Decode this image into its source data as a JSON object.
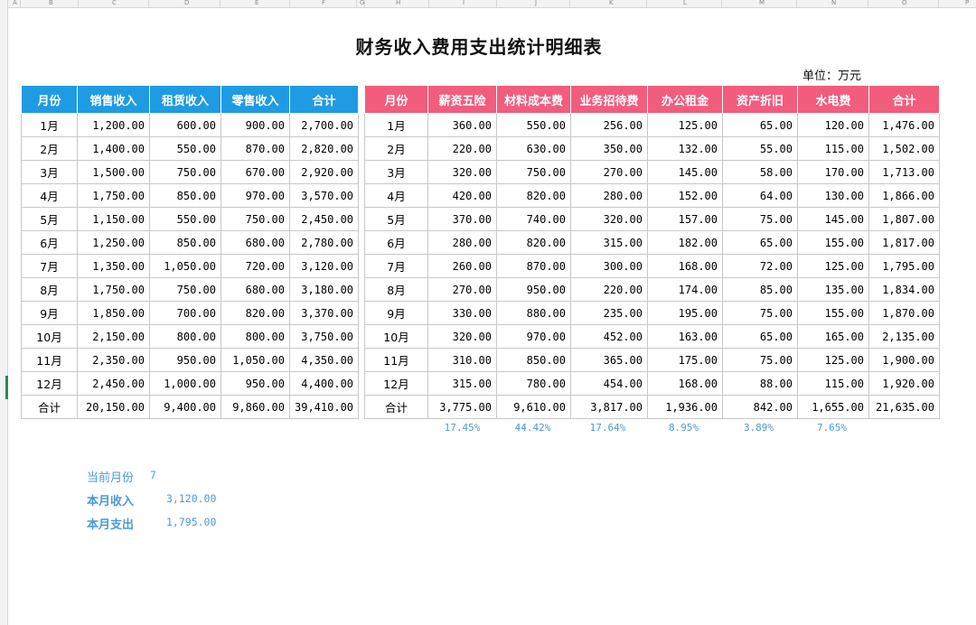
{
  "sheet": {
    "columns": [
      "A",
      "B",
      "C",
      "D",
      "E",
      "F",
      "G",
      "H",
      "I",
      "J",
      "K",
      "L",
      "M",
      "N",
      "O",
      "P"
    ],
    "title": "财务收入费用支出统计明细表",
    "unit": "单位：万元"
  },
  "income": {
    "headers": [
      "月份",
      "销售收入",
      "租赁收入",
      "零售收入",
      "合计"
    ],
    "rows": [
      [
        "1月",
        "1,200.00",
        "600.00",
        "900.00",
        "2,700.00"
      ],
      [
        "2月",
        "1,400.00",
        "550.00",
        "870.00",
        "2,820.00"
      ],
      [
        "3月",
        "1,500.00",
        "750.00",
        "670.00",
        "2,920.00"
      ],
      [
        "4月",
        "1,750.00",
        "850.00",
        "970.00",
        "3,570.00"
      ],
      [
        "5月",
        "1,150.00",
        "550.00",
        "750.00",
        "2,450.00"
      ],
      [
        "6月",
        "1,250.00",
        "850.00",
        "680.00",
        "2,780.00"
      ],
      [
        "7月",
        "1,350.00",
        "1,050.00",
        "720.00",
        "3,120.00"
      ],
      [
        "8月",
        "1,750.00",
        "750.00",
        "680.00",
        "3,180.00"
      ],
      [
        "9月",
        "1,850.00",
        "700.00",
        "820.00",
        "3,370.00"
      ],
      [
        "10月",
        "2,150.00",
        "800.00",
        "800.00",
        "3,750.00"
      ],
      [
        "11月",
        "2,350.00",
        "950.00",
        "1,050.00",
        "4,350.00"
      ],
      [
        "12月",
        "2,450.00",
        "1,000.00",
        "950.00",
        "4,400.00"
      ],
      [
        "合计",
        "20,150.00",
        "9,400.00",
        "9,860.00",
        "39,410.00"
      ]
    ]
  },
  "expense": {
    "headers": [
      "月份",
      "薪资五险",
      "材料成本费",
      "业务招待费",
      "办公租金",
      "资产折旧",
      "水电费",
      "合计"
    ],
    "rows": [
      [
        "1月",
        "360.00",
        "550.00",
        "256.00",
        "125.00",
        "65.00",
        "120.00",
        "1,476.00"
      ],
      [
        "2月",
        "220.00",
        "630.00",
        "350.00",
        "132.00",
        "55.00",
        "115.00",
        "1,502.00"
      ],
      [
        "3月",
        "320.00",
        "750.00",
        "270.00",
        "145.00",
        "58.00",
        "170.00",
        "1,713.00"
      ],
      [
        "4月",
        "420.00",
        "820.00",
        "280.00",
        "152.00",
        "64.00",
        "130.00",
        "1,866.00"
      ],
      [
        "5月",
        "370.00",
        "740.00",
        "320.00",
        "157.00",
        "75.00",
        "145.00",
        "1,807.00"
      ],
      [
        "6月",
        "280.00",
        "820.00",
        "315.00",
        "182.00",
        "65.00",
        "155.00",
        "1,817.00"
      ],
      [
        "7月",
        "260.00",
        "870.00",
        "300.00",
        "168.00",
        "72.00",
        "125.00",
        "1,795.00"
      ],
      [
        "8月",
        "270.00",
        "950.00",
        "220.00",
        "174.00",
        "85.00",
        "135.00",
        "1,834.00"
      ],
      [
        "9月",
        "330.00",
        "880.00",
        "235.00",
        "195.00",
        "75.00",
        "155.00",
        "1,870.00"
      ],
      [
        "10月",
        "320.00",
        "970.00",
        "452.00",
        "163.00",
        "65.00",
        "165.00",
        "2,135.00"
      ],
      [
        "11月",
        "310.00",
        "850.00",
        "365.00",
        "175.00",
        "75.00",
        "125.00",
        "1,900.00"
      ],
      [
        "12月",
        "315.00",
        "780.00",
        "454.00",
        "168.00",
        "88.00",
        "115.00",
        "1,920.00"
      ],
      [
        "合计",
        "3,775.00",
        "9,610.00",
        "3,817.00",
        "1,936.00",
        "842.00",
        "1,655.00",
        "21,635.00"
      ]
    ],
    "percentages": [
      "17.45%",
      "44.42%",
      "17.64%",
      "8.95%",
      "3.89%",
      "7.65%"
    ]
  },
  "summary": {
    "current_month_label": "当前月份",
    "current_month_value": "7",
    "month_income_label": "本月收入",
    "month_income_value": "3,120.00",
    "month_expense_label": "本月支出",
    "month_expense_value": "1,795.00"
  },
  "colors": {
    "income_header": "#1e9be2",
    "expense_header": "#f25c7d",
    "summary_text": "#4a9ad4"
  }
}
